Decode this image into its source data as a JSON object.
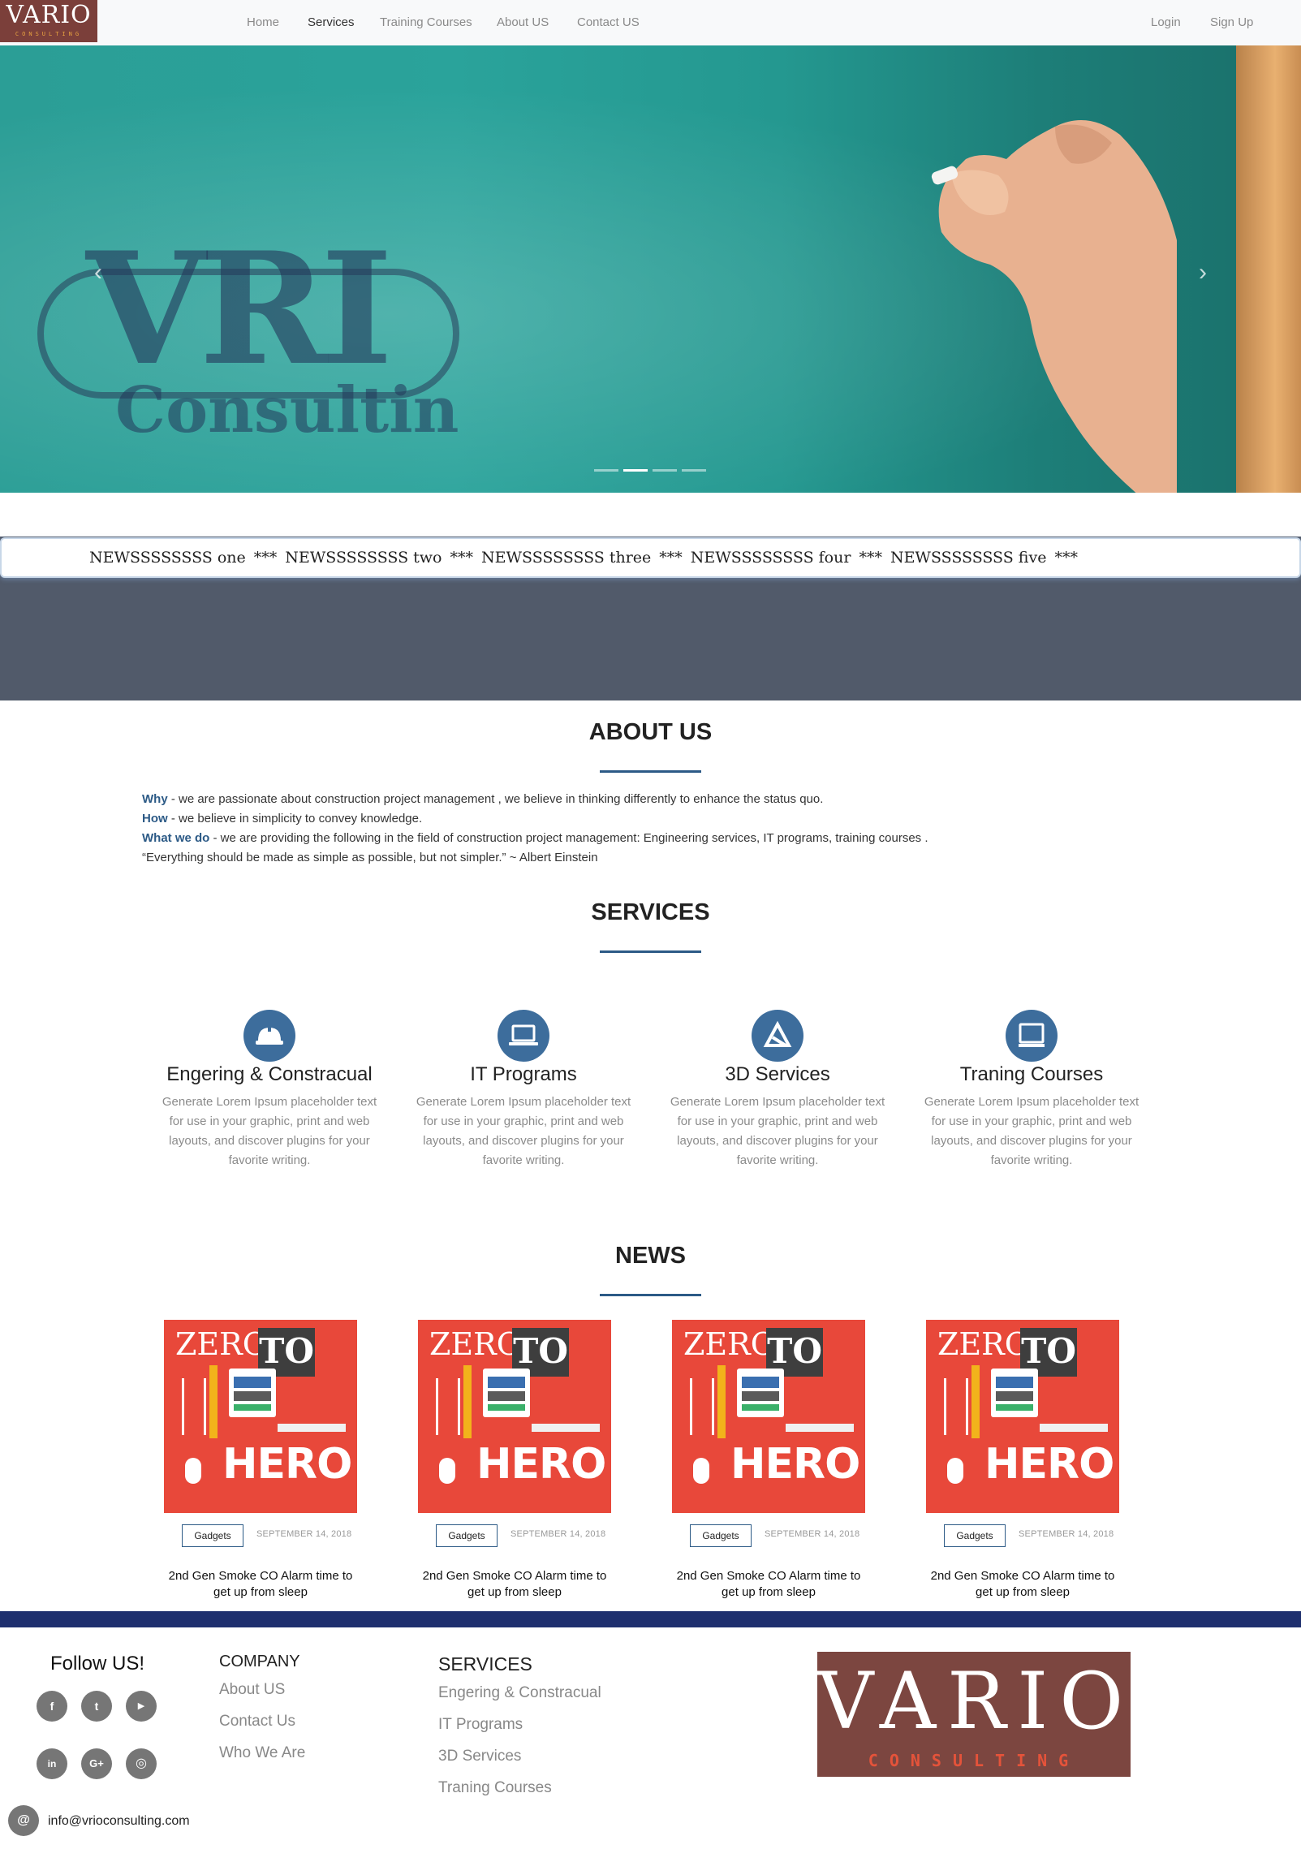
{
  "nav": {
    "logo_word": "VARIO",
    "logo_sub": "CONSULTING",
    "links": [
      "Home",
      "Services",
      "Training Courses",
      "About US",
      "Contact US"
    ],
    "active": "Services",
    "login": "Login",
    "signup": "Sign Up"
  },
  "hero": {
    "logo_big": "VRI",
    "logo_small": "Consultin",
    "prev_icon": "chevron-left-icon",
    "next_icon": "chevron-right-icon",
    "slide_count": 4,
    "active_slide": 2
  },
  "ticker": {
    "items": [
      "NEWSSSSSSSS one",
      "NEWSSSSSSSS two",
      "NEWSSSSSSSS three",
      "NEWSSSSSSSS four",
      "NEWSSSSSSSS five"
    ],
    "separator": "***"
  },
  "about": {
    "title": "ABOUT US",
    "why_key": "Why",
    "why_text": " - we are passionate about construction project management , we believe in thinking differently to enhance the status quo.",
    "how_key": "How",
    "how_text": " - we believe in simplicity to convey knowledge.",
    "what_key": "What we do",
    "what_text": " - we are providing the following in the field of construction project management: Engineering services, IT programs, training courses .",
    "quote": "“Everything should be made as simple as possible, but not simpler.” ~ Albert Einstein"
  },
  "services": {
    "title": "SERVICES",
    "items": [
      {
        "title": "Engering & Constracual",
        "icon": "hard-hat-icon",
        "desc": "Generate Lorem Ipsum placeholder text for use in your graphic, print and web layouts, and discover plugins for your favorite writing."
      },
      {
        "title": "IT Programs",
        "icon": "laptop-icon",
        "desc": "Generate Lorem Ipsum placeholder text for use in your graphic, print and web layouts, and discover plugins for your favorite writing."
      },
      {
        "title": "3D Services",
        "icon": "3d-logo-icon",
        "desc": "Generate Lorem Ipsum placeholder text for use in your graphic, print and web layouts, and discover plugins for your favorite writing."
      },
      {
        "title": "Traning Courses",
        "icon": "monitor-icon",
        "desc": "Generate Lorem Ipsum placeholder text for use in your graphic, print and web layouts, and discover plugins for your favorite writing."
      }
    ]
  },
  "news": {
    "title": "NEWS",
    "cards": [
      {
        "img_top": "ZERO",
        "img_to": "TO",
        "img_bottom": "HERO",
        "tag": "Gadgets",
        "date": "SEPTEMBER 14, 2018",
        "title": "2nd Gen Smoke CO Alarm time to get up from sleep"
      },
      {
        "img_top": "ZERO",
        "img_to": "TO",
        "img_bottom": "HERO",
        "tag": "Gadgets",
        "date": "SEPTEMBER 14, 2018",
        "title": "2nd Gen Smoke CO Alarm time to get up from sleep"
      },
      {
        "img_top": "ZERO",
        "img_to": "TO",
        "img_bottom": "HERO",
        "tag": "Gadgets",
        "date": "SEPTEMBER 14, 2018",
        "title": "2nd Gen Smoke CO Alarm time to get up from sleep"
      },
      {
        "img_top": "ZERO",
        "img_to": "TO",
        "img_bottom": "HERO",
        "tag": "Gadgets",
        "date": "SEPTEMBER 14, 2018",
        "title": "2nd Gen Smoke CO Alarm time to get up from sleep"
      }
    ]
  },
  "footer": {
    "follow": "Follow US!",
    "social": [
      {
        "icon": "facebook-icon",
        "glyph": "f"
      },
      {
        "icon": "twitter-icon",
        "glyph": "t"
      },
      {
        "icon": "youtube-icon",
        "glyph": "▶"
      },
      {
        "icon": "linkedin-icon",
        "glyph": "in"
      },
      {
        "icon": "google-plus-icon",
        "glyph": "G+"
      },
      {
        "icon": "instagram-icon",
        "glyph": "◎"
      }
    ],
    "company_title": "COMPANY",
    "company_links": [
      "About US",
      "Contact Us",
      "Who We Are"
    ],
    "services_title": "SERVICES",
    "services_links": [
      "Engering & Constracual",
      "IT Programs",
      "3D Services",
      "Traning Courses"
    ],
    "logo_word": "VARIO",
    "logo_sub": "CONSULTING",
    "email_glyph": "@",
    "email": "info@vrioconsulting.com"
  },
  "colors": {
    "accent": "#2c5a86",
    "service_icon_bg": "#3d6d9c",
    "footer_bar": "#1e2f6e",
    "ticker_band": "#515a6a",
    "news_image_bg": "#e8483a",
    "logo_bg": "#7c4640"
  }
}
